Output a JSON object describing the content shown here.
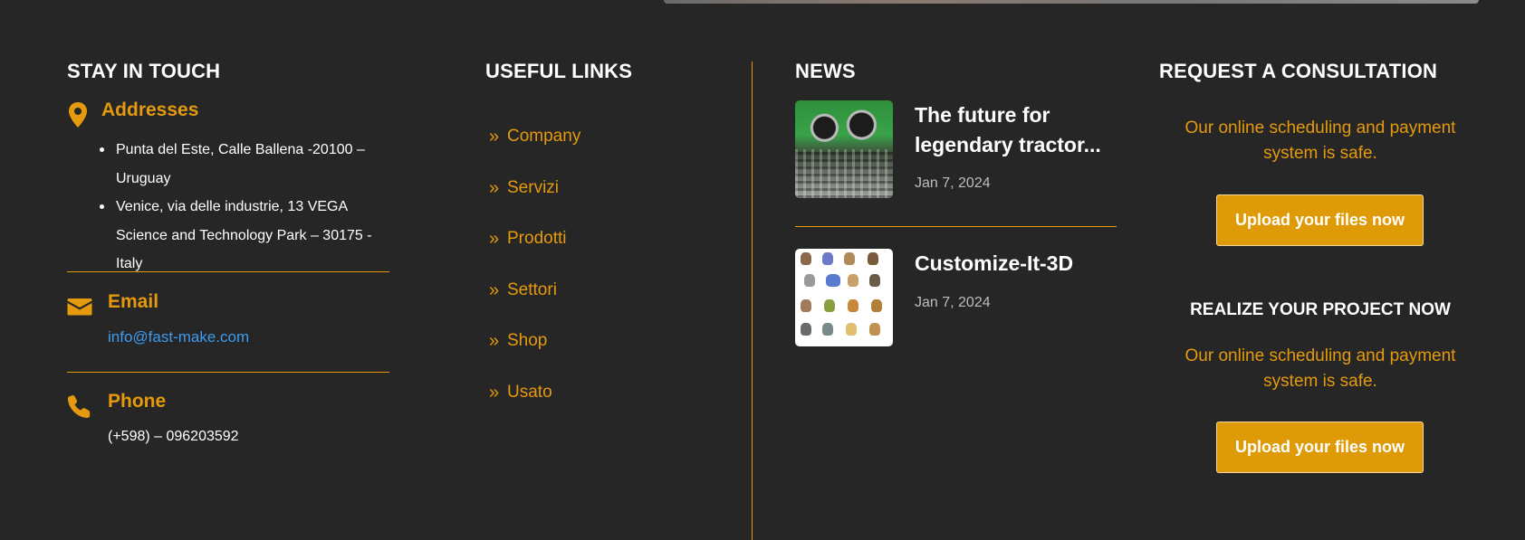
{
  "contact": {
    "heading": "STAY IN TOUCH",
    "addresses": {
      "title": "Addresses",
      "icon": "map-pin-icon",
      "items": [
        "Punta del Este, Calle Ballena -20100 – Uruguay",
        "Venice, via delle industrie, 13 VEGA Science and Technology Park – 30175 -Italy"
      ]
    },
    "email": {
      "title": "Email",
      "icon": "envelope-icon",
      "value": "info@fast-make.com"
    },
    "phone": {
      "title": "Phone",
      "icon": "phone-icon",
      "value": "(+598) – 096203592"
    }
  },
  "useful_links": {
    "heading": "USEFUL LINKS",
    "items": [
      "Company",
      "Servizi",
      "Prodotti",
      "Settori",
      "Shop",
      "Usato"
    ]
  },
  "news": {
    "heading": "NEWS",
    "items": [
      {
        "title": "The future for legendary tractor...",
        "date": "Jan 7, 2024"
      },
      {
        "title": "Customize-It-3D",
        "date": "Jan 7, 2024"
      }
    ]
  },
  "consultation": {
    "heading": "REQUEST A CONSULTATION",
    "text1": "Our online scheduling and payment system is safe.",
    "button1": "Upload your files now",
    "subheading": "REALIZE YOUR PROJECT NOW",
    "text2": "Our online scheduling and payment system is safe.",
    "button2": "Upload your files now"
  },
  "colors": {
    "background": "#262626",
    "accent": "#e59a0e",
    "link": "#3d9cf0",
    "button": "#df9b07"
  }
}
